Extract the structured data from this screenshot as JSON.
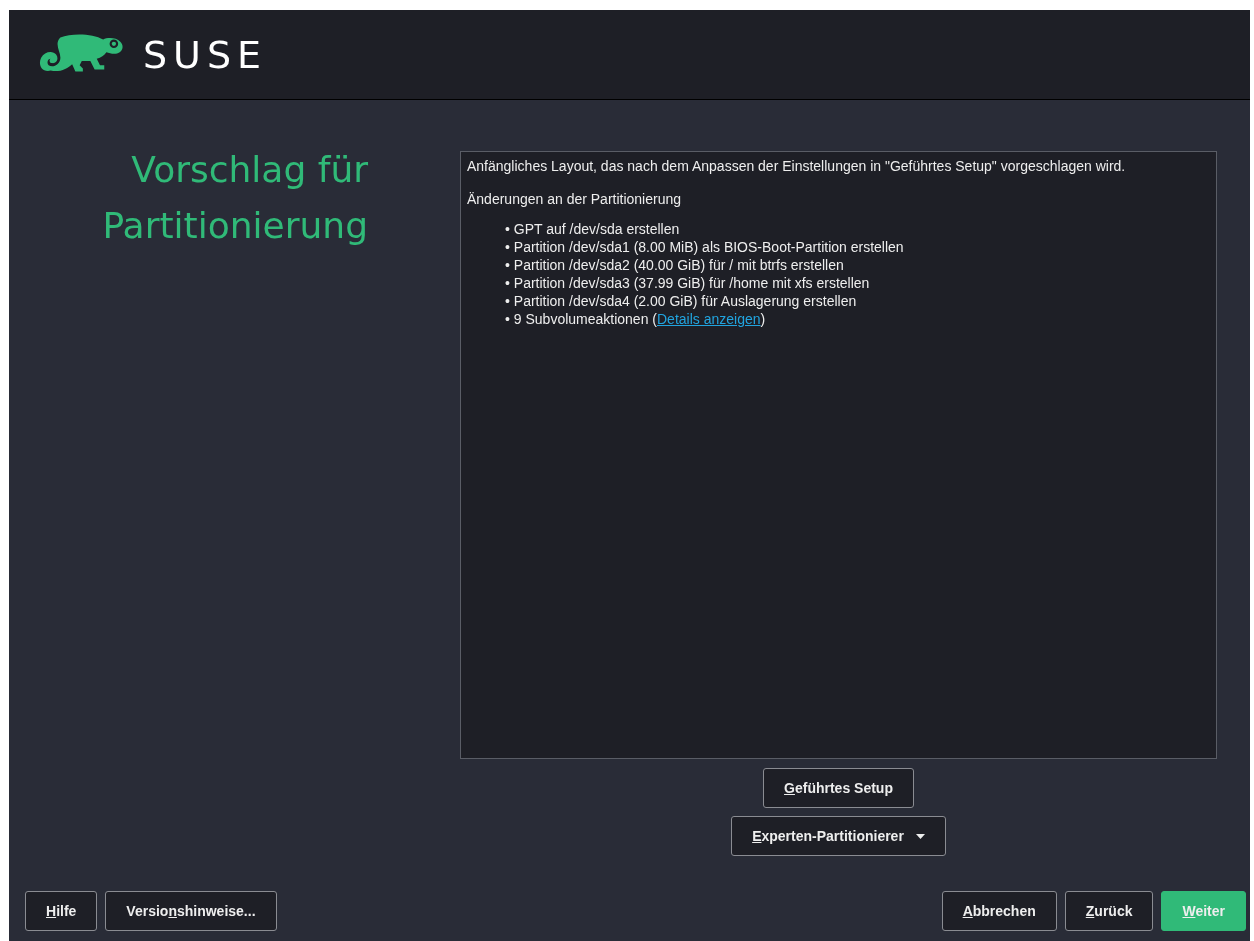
{
  "header": {
    "brand": "SUSE"
  },
  "title": {
    "lines": [
      "Vorschlag für",
      "Partitionierung"
    ]
  },
  "proposal": {
    "intro": "Anfängliches Layout, das nach dem Anpassen der Einstellungen in \"Geführtes Setup\" vorgeschlagen wird.",
    "heading": "Änderungen an der Partitionierung",
    "items": [
      {
        "bullet": "•",
        "text": "GPT auf /dev/sda erstellen"
      },
      {
        "bullet": "•",
        "text": "Partition /dev/sda1 (8.00 MiB) als BIOS-Boot-Partition erstellen"
      },
      {
        "bullet": "•",
        "text": "Partition /dev/sda2 (40.00 GiB) für / mit btrfs erstellen"
      },
      {
        "bullet": "•",
        "text": "Partition /dev/sda3 (37.99 GiB) für /home mit xfs erstellen"
      },
      {
        "bullet": "•",
        "text": "Partition /dev/sda4 (2.00 GiB) für Auslagerung erstellen"
      },
      {
        "bullet": "•",
        "text": "9 Subvolumeaktionen (",
        "link": "Details anzeigen",
        "after": ")"
      }
    ]
  },
  "actions": [
    {
      "kind": "plain",
      "key": "G",
      "post": "eführtes Setup"
    },
    {
      "kind": "menu",
      "key": "E",
      "post": "xperten-Partitionierer"
    }
  ],
  "footer": {
    "left": [
      {
        "kind": "plain",
        "key": "H",
        "post": "ilfe"
      },
      {
        "kind": "plain",
        "pre": "Versio",
        "key": "n",
        "post": "shinweise..."
      }
    ],
    "right": [
      {
        "kind": "plain",
        "key": "A",
        "post": "bbrechen"
      },
      {
        "kind": "plain",
        "key": "Z",
        "post": "urück"
      },
      {
        "kind": "primary",
        "key": "W",
        "post": "eiter"
      }
    ]
  }
}
